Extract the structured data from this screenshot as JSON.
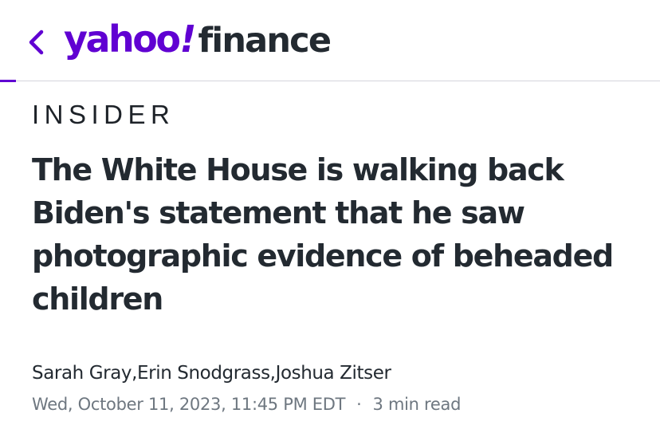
{
  "header": {
    "back_icon": "chevron-left-icon",
    "logo": {
      "yahoo": "yahoo",
      "bang": "!",
      "finance": "finance"
    },
    "colors": {
      "brand_purple": "#6001d2",
      "text_dark": "#232a31",
      "text_muted": "#6e7780",
      "divider": "#d4d4dc"
    }
  },
  "article": {
    "publisher": "INSIDER",
    "headline": "The White House is walking back Biden's statement that he saw photographic evidence of beheaded children",
    "authors": "Sarah Gray,Erin Snodgrass,Joshua Zitser",
    "timestamp": "Wed, October 11, 2023, 11:45 PM EDT",
    "separator": "·",
    "read_time": "3 min read"
  }
}
